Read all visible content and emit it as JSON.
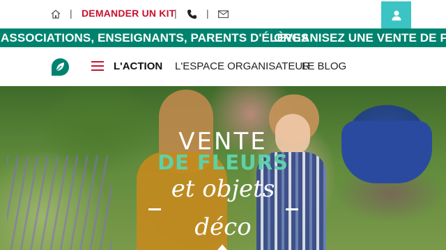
{
  "topbar": {
    "home_icon": "home-icon",
    "sep": "|",
    "kit_label": "DEMANDER UN KIT",
    "phone_icon": "phone-icon",
    "mail_icon": "mail-icon",
    "account_icon": "user-icon"
  },
  "marquee": {
    "message_1": "ASSOCIATIONS, ENSEIGNANTS, PARENTS D'ÉLÈVES",
    "message_2": "ORGANISEZ UNE VENTE DE FLEURS"
  },
  "nav": {
    "logo_icon": "leaf-logo-icon",
    "menu_icon": "hamburger-icon",
    "items": [
      {
        "label": "L'ACTION"
      },
      {
        "label": "L'ESPACE ORGANISATEUR"
      },
      {
        "label": "LE BLOG"
      }
    ]
  },
  "hero": {
    "line1": "VENTE",
    "line2": "DE FLEURS",
    "line3": "et objets",
    "line4": "déco"
  },
  "colors": {
    "brand_red": "#c8102e",
    "brand_green": "#00836e",
    "accent_mint": "#5ed1a8",
    "account_teal": "#3cc4c4"
  }
}
